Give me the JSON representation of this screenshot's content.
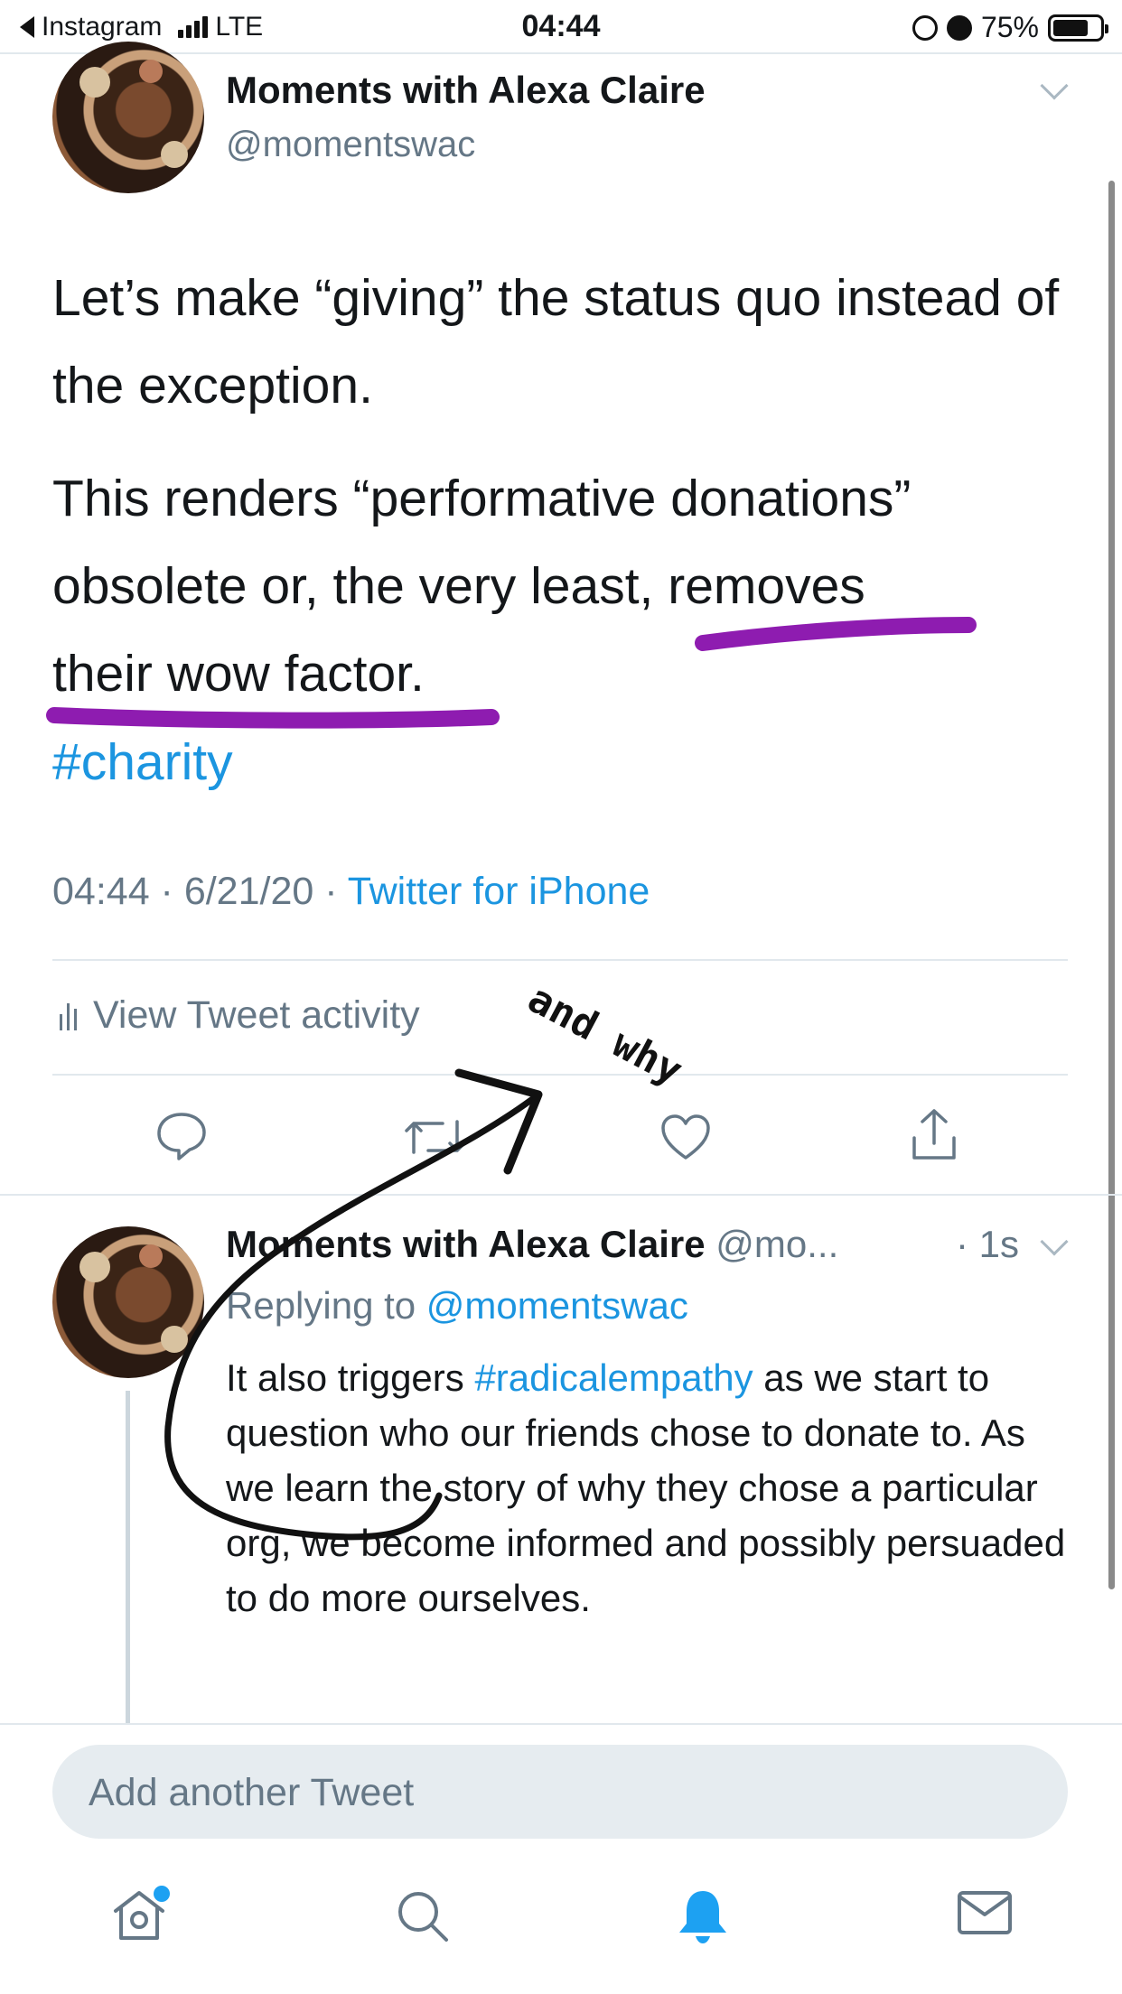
{
  "status_bar": {
    "back_app": "Instagram",
    "network": "LTE",
    "time": "04:44",
    "battery": "75%",
    "battery_level": 0.75
  },
  "tweet": {
    "author_name": "Moments with Alexa Claire",
    "author_handle": "@momentswac",
    "paragraph1": "Let’s make “giving” the status quo instead of the exception.",
    "paragraph2_line1": "This renders “performative donations”",
    "paragraph2_line2": "obsolete or, the very least, removes",
    "paragraph2_line3": "their wow factor.",
    "hashtag": "#charity",
    "timestamp": "04:44 · 6/21/20 · ",
    "source": "Twitter for iPhone",
    "activity_label": "View Tweet activity"
  },
  "annotation": {
    "handwritten_text": "and why",
    "underline_color": "#8e1cb0"
  },
  "reply": {
    "author_name": "Moments with Alexa Claire",
    "author_handle_truncated": "@mo...",
    "time": "· 1s",
    "replying_prefix": "Replying to ",
    "replying_to": "@momentswac",
    "text_before": "It also triggers ",
    "text_hashtag": "#radicalempathy",
    "text_after": " as we start to question who our friends chose to donate to. As we learn the story of why they chose a particular org, we become informed and possibly persuaded to do more ourselves."
  },
  "compose": {
    "placeholder": "Add another Tweet"
  },
  "colors": {
    "link_blue": "#1b95e0",
    "secondary_text": "#657786",
    "active_tab": "#1da1f2"
  }
}
